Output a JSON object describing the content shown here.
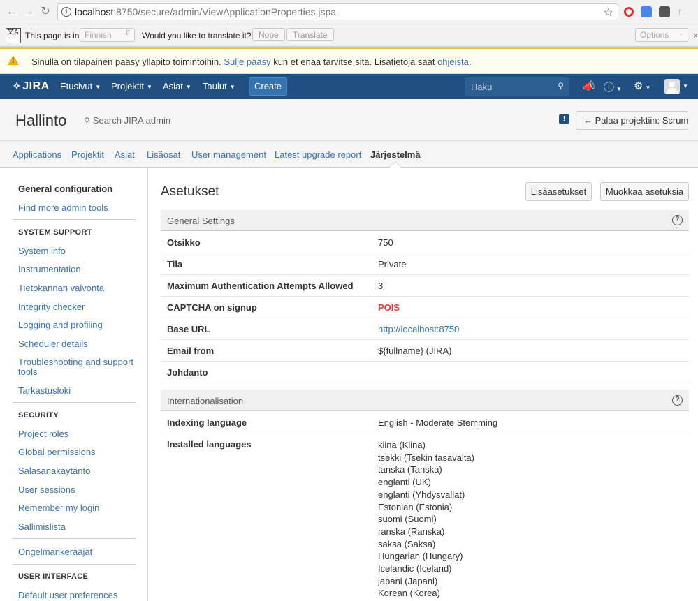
{
  "browser": {
    "url_host": "localhost",
    "url_path": ":8750/secure/admin/ViewApplicationProperties.jspa"
  },
  "translate_bar": {
    "page_is_in": "This page is in",
    "language": "Finnish",
    "question": "Would you like to translate it?",
    "nope": "Nope",
    "translate": "Translate",
    "options": "Options"
  },
  "warning": {
    "text_before": "Sinulla on tilapäinen pääsy ylläpito toimintoihin.",
    "link1": "Sulje pääsy",
    "text_middle": "kun et enää tarvitse sitä. Lisätietoja saat",
    "link2": "ohjeista",
    "text_end": "."
  },
  "header": {
    "logo": "JIRA",
    "nav": [
      "Etusivut",
      "Projektit",
      "Asiat",
      "Taulut"
    ],
    "create": "Create",
    "search_placeholder": "Haku"
  },
  "admin": {
    "title": "Hallinto",
    "search": "Search JIRA admin",
    "back_button": "Palaa projektiin: Scrum",
    "tabs": [
      "Applications",
      "Projektit",
      "Asiat",
      "Lisäosat",
      "User management",
      "Latest upgrade report",
      "Järjestelmä"
    ]
  },
  "sidebar": {
    "general_configuration": "General configuration",
    "find_more": "Find more admin tools",
    "system_support_head": "SYSTEM SUPPORT",
    "system_support": [
      "System info",
      "Instrumentation",
      "Tietokannan valvonta",
      "Integrity checker",
      "Logging and profiling",
      "Scheduler details",
      "Troubleshooting and support tools",
      "Tarkastusloki"
    ],
    "security_head": "SECURITY",
    "security": [
      "Project roles",
      "Global permissions",
      "Salasanakäytäntö",
      "User sessions",
      "Remember my login",
      "Sallimislista"
    ],
    "ongelma": "Ongelmankerääjät",
    "user_interface_head": "USER INTERFACE",
    "user_interface": [
      "Default user preferences"
    ]
  },
  "main": {
    "title": "Asetukset",
    "btn_advanced": "Lisäasetukset",
    "btn_edit": "Muokkaa asetuksia",
    "general_settings": {
      "heading": "General Settings",
      "rows": [
        {
          "key": "Otsikko",
          "value": "750"
        },
        {
          "key": "Tila",
          "value": "Private"
        },
        {
          "key": "Maximum Authentication Attempts Allowed",
          "value": "3"
        },
        {
          "key": "CAPTCHA on signup",
          "value": "POIS"
        },
        {
          "key": "Base URL",
          "value": "http://localhost:8750"
        },
        {
          "key": "Email from",
          "value": "${fullname} (JIRA)"
        },
        {
          "key": "Johdanto",
          "value": ""
        }
      ]
    },
    "internationalisation": {
      "heading": "Internationalisation",
      "indexing_key": "Indexing language",
      "indexing_value": "English - Moderate Stemming",
      "installed_key": "Installed languages",
      "languages": [
        "kiina (Kiina)",
        "tsekki (Tsekin tasavalta)",
        "tanska (Tanska)",
        "englanti (UK)",
        "englanti (Yhdysvallat)",
        "Estonian (Estonia)",
        "suomi (Suomi)",
        "ranska (Ranska)",
        "saksa (Saksa)",
        "Hungarian (Hungary)",
        "Icelandic (Iceland)",
        "japani (Japani)",
        "Korean (Korea)"
      ]
    }
  },
  "colors": {
    "header_bg": "#205081",
    "link": "#3b73af",
    "danger": "#d04437",
    "warning": "#f2c04a"
  }
}
